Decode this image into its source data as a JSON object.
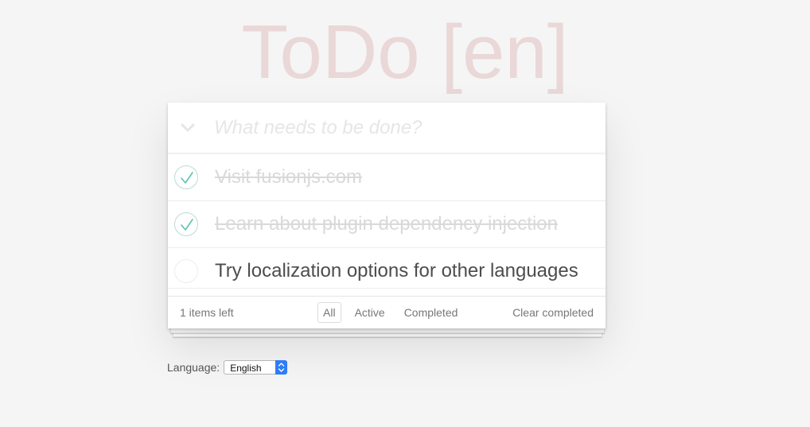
{
  "header": {
    "title": "ToDo [en]"
  },
  "new_todo": {
    "placeholder": "What needs to be done?",
    "value": ""
  },
  "todos": [
    {
      "label": "Visit fusionjs.com",
      "completed": true
    },
    {
      "label": "Learn about plugin dependency injection",
      "completed": true
    },
    {
      "label": "Try localization options for other languages",
      "completed": false
    }
  ],
  "footer": {
    "items_left": "1 items left",
    "filters": [
      "All",
      "Active",
      "Completed"
    ],
    "selected_filter": "All",
    "clear_completed": "Clear completed"
  },
  "language": {
    "label": "Language:",
    "selected": "English"
  },
  "colors": {
    "title": "#efd5d5",
    "check_mark": "#5dc2af",
    "select_arrow": "#2d7df6"
  }
}
